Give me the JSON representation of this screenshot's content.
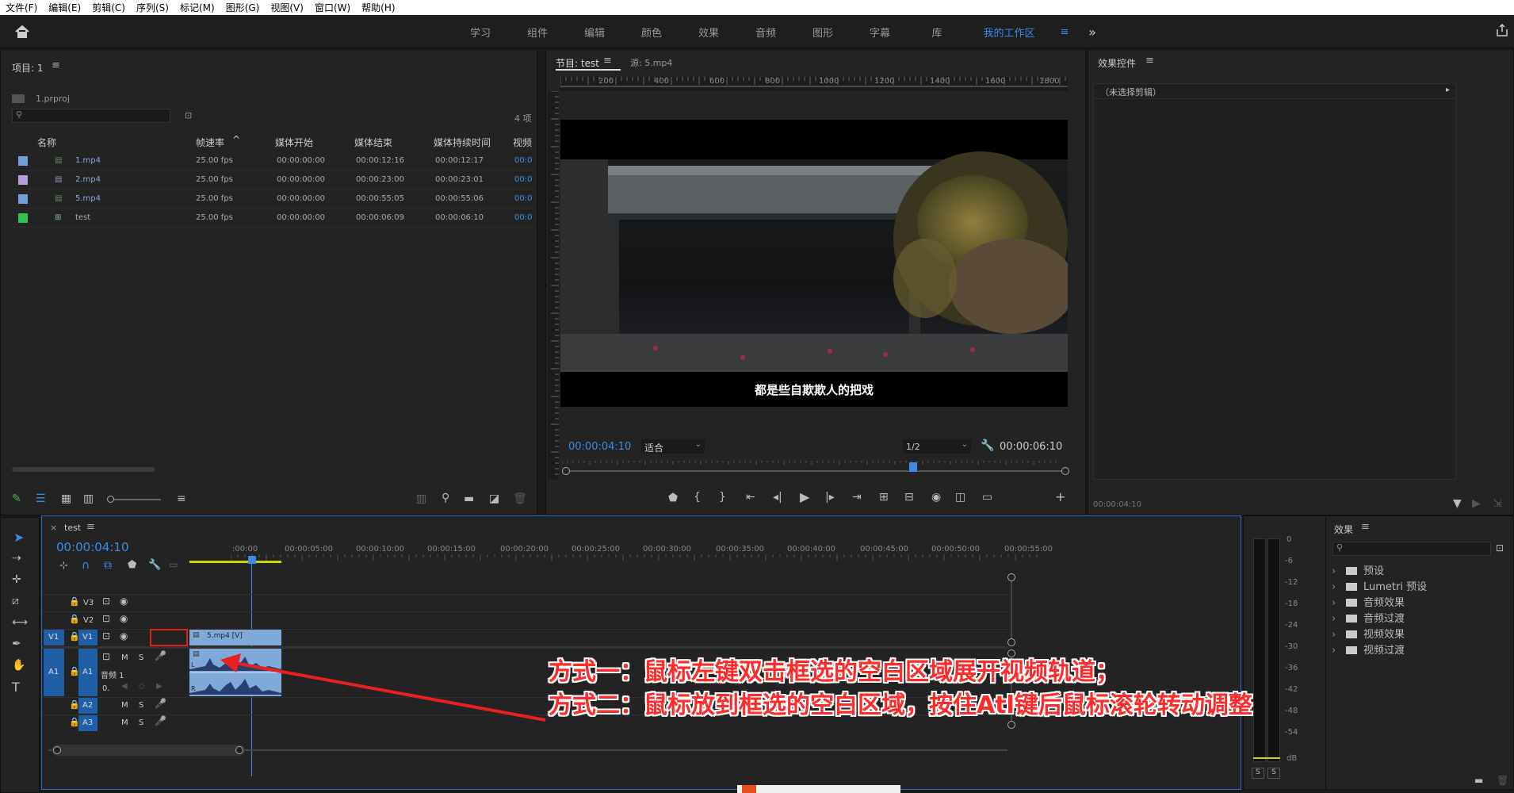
{
  "menu": [
    "文件(F)",
    "编辑(E)",
    "剪辑(C)",
    "序列(S)",
    "标记(M)",
    "图形(G)",
    "视图(V)",
    "窗口(W)",
    "帮助(H)"
  ],
  "workspace_tabs": [
    "学习",
    "组件",
    "编辑",
    "颜色",
    "效果",
    "音频",
    "图形",
    "字幕",
    "库",
    "我的工作区"
  ],
  "workspace_active": "我的工作区",
  "project": {
    "title": "项目: 1",
    "file": "1.prproj",
    "item_count": "4 项",
    "columns": [
      "名称",
      "帧速率",
      "媒体开始",
      "媒体结束",
      "媒体持续时间",
      "视频"
    ],
    "rows": [
      {
        "name": "1.mp4",
        "fps": "25.00 fps",
        "start": "00:00:00:00",
        "end": "00:00:12:16",
        "dur": "00:00:12:17",
        "v": "00:0",
        "color": "#6f9fd8"
      },
      {
        "name": "2.mp4",
        "fps": "25.00 fps",
        "start": "00:00:00:00",
        "end": "00:00:23:00",
        "dur": "00:00:23:01",
        "v": "00:0",
        "color": "#b39ddb"
      },
      {
        "name": "5.mp4",
        "fps": "25.00 fps",
        "start": "00:00:00:00",
        "end": "00:00:55:05",
        "dur": "00:00:55:06",
        "v": "00:0",
        "color": "#6f9fd8"
      },
      {
        "name": "test",
        "fps": "25.00 fps",
        "start": "00:00:00:00",
        "end": "00:00:06:09",
        "dur": "00:00:06:10",
        "v": "00:0",
        "color": "#35c04f"
      }
    ]
  },
  "program": {
    "tab_program": "节目: test",
    "tab_source": "源: 5.mp4",
    "ruler_ticks": [
      "200",
      "400",
      "600",
      "800",
      "1000",
      "1200",
      "1400",
      "1600",
      "1800"
    ],
    "subtitle": "都是些自欺欺人的把戏",
    "timecode_left": "00:00:04:10",
    "fit": "适合",
    "resolution": "1/2",
    "timecode_right": "00:00:06:10"
  },
  "effect_controls": {
    "title": "效果控件",
    "no_clip": "（未选择剪辑）",
    "timecode": "00:00:04:10"
  },
  "timeline": {
    "tab": "test",
    "timecode": "00:00:04:10",
    "ruler": [
      ":00:00",
      "00:00:05:00",
      "00:00:10:00",
      "00:00:15:00",
      "00:00:20:00",
      "00:00:25:00",
      "00:00:30:00",
      "00:00:35:00",
      "00:00:40:00",
      "00:00:45:00",
      "00:00:50:00",
      "00:00:55:00"
    ],
    "tracks": {
      "v3": "V3",
      "v2": "V2",
      "v1": "V1",
      "v1_src": "V1",
      "a1": "A1",
      "a1_src": "A1",
      "a2": "A2",
      "a3": "A3",
      "m": "M",
      "s": "S",
      "audio1": "音频 1",
      "o": "0."
    },
    "clip_label": "5.mp4 [V]"
  },
  "meter": {
    "scale": [
      "0",
      "-6",
      "-12",
      "-18",
      "-24",
      "-30",
      "-36",
      "-42",
      "-48",
      "-54",
      "dB"
    ],
    "s_left": "S",
    "s_right": "S"
  },
  "effects_panel": {
    "title": "效果",
    "items": [
      "预设",
      "Lumetri 预设",
      "音频效果",
      "音频过渡",
      "视频效果",
      "视频过渡"
    ]
  },
  "annotation": {
    "line1": "方式一：鼠标左键双击框选的空白区域展开视频轨道；",
    "line2": "方式二：鼠标放到框选的空白区域，按住Atl键后鼠标滚轮转动调整"
  }
}
